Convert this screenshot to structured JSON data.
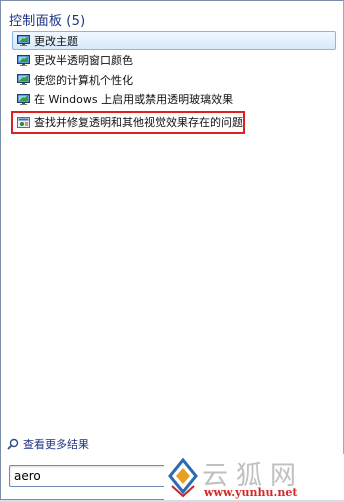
{
  "group": {
    "title": "控制面板",
    "count": "(5)"
  },
  "results": [
    {
      "label": "更改主题",
      "icon": "display-settings-icon",
      "highlighted": true
    },
    {
      "label": "更改半透明窗口颜色",
      "icon": "display-settings-icon"
    },
    {
      "label": "使您的计算机个性化",
      "icon": "display-settings-icon"
    },
    {
      "label": "在 Windows 上启用或禁用透明玻璃效果",
      "icon": "display-settings-icon"
    },
    {
      "label": "查找并修复透明和其他视觉效果存在的问题",
      "icon": "troubleshoot-icon",
      "boxed": true
    }
  ],
  "see_more": {
    "label": "查看更多结果",
    "icon": "search-icon"
  },
  "search": {
    "value": "aero"
  },
  "watermark": {
    "chars": "云狐网",
    "url": "www.yunhu.net"
  },
  "colors": {
    "header_text": "#1e3287",
    "highlight_border": "#8ab6e6",
    "annotation_red": "#e02020",
    "watermark_red": "#d22a2a"
  }
}
